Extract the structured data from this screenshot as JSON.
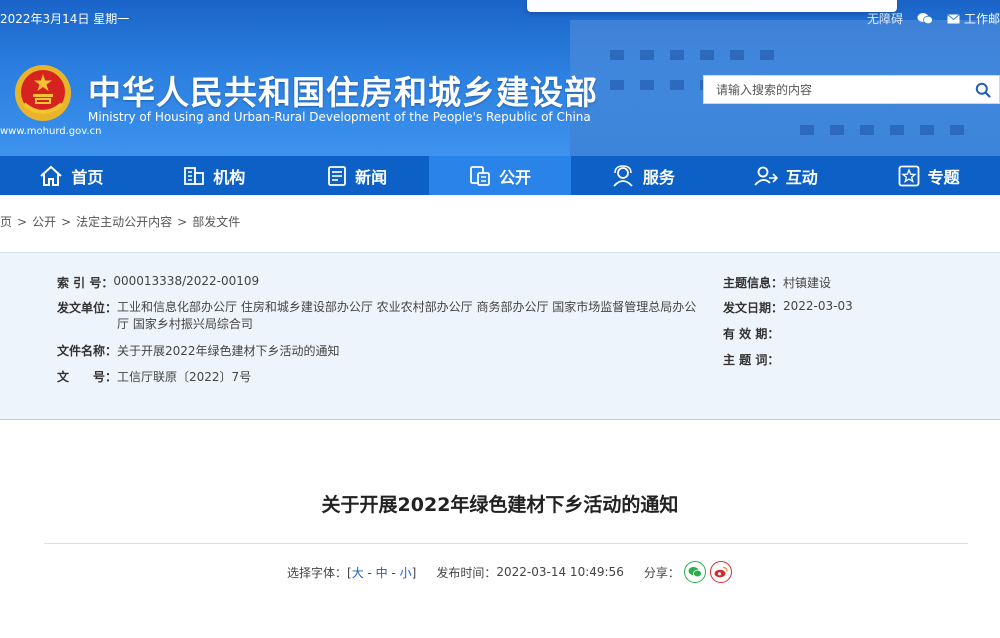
{
  "header": {
    "date": "2022年3月14日 星期一",
    "accessibility": "无障碍",
    "work_link": "工作邮",
    "title_cn": "中华人民共和国住房和城乡建设部",
    "title_en": "Ministry of Housing and Urban-Rural Development of the People's Republic of China",
    "site_url": "www.mohurd.gov.cn",
    "search_placeholder": "请输入搜索的内容"
  },
  "nav": {
    "items": [
      {
        "label": "首页",
        "icon": "home-icon"
      },
      {
        "label": "机构",
        "icon": "building-icon"
      },
      {
        "label": "新闻",
        "icon": "news-icon"
      },
      {
        "label": "公开",
        "icon": "disclosure-icon",
        "active": true
      },
      {
        "label": "服务",
        "icon": "service-icon"
      },
      {
        "label": "互动",
        "icon": "interaction-icon"
      },
      {
        "label": "专题",
        "icon": "star-icon"
      }
    ]
  },
  "breadcrumb": [
    "首页",
    "公开",
    "法定主动公开内容",
    "部发文件"
  ],
  "info": {
    "index_label": "索 引 号：",
    "index_value": "000013338/2022-00109",
    "issuer_label": "发文单位：",
    "issuer_value": "工业和信息化部办公厅 住房和城乡建设部办公厅 农业农村部办公厅 商务部办公厅 国家市场监督管理总局办公厅 国家乡村振兴局综合司",
    "filename_label": "文件名称：",
    "filename_value": "关于开展2022年绿色建材下乡活动的通知",
    "docno_label": "文　　号：",
    "docno_value": "工信厅联原〔2022〕7号",
    "topic_label": "主题信息：",
    "topic_value": "村镇建设",
    "date_label": "发文日期：",
    "date_value": "2022-03-03",
    "valid_label": "有 效 期：",
    "valid_value": "",
    "keywords_label": "主 题 词：",
    "keywords_value": ""
  },
  "article": {
    "title": "关于开展2022年绿色建材下乡活动的通知",
    "font_select_label": "选择字体：[",
    "font_large": "大",
    "font_medium": "中",
    "font_small": "小",
    "font_select_end": "]",
    "publish_label": "发布时间：",
    "publish_time": "2022-03-14 10:49:56",
    "share_label": "分享："
  },
  "colors": {
    "header_blue": "#2b7fe0",
    "nav_blue": "#0c60c6",
    "nav_active": "#2a83e8",
    "info_bg": "#eef4fb",
    "wechat_green": "#2aae4a",
    "weibo_red": "#d8282e"
  }
}
